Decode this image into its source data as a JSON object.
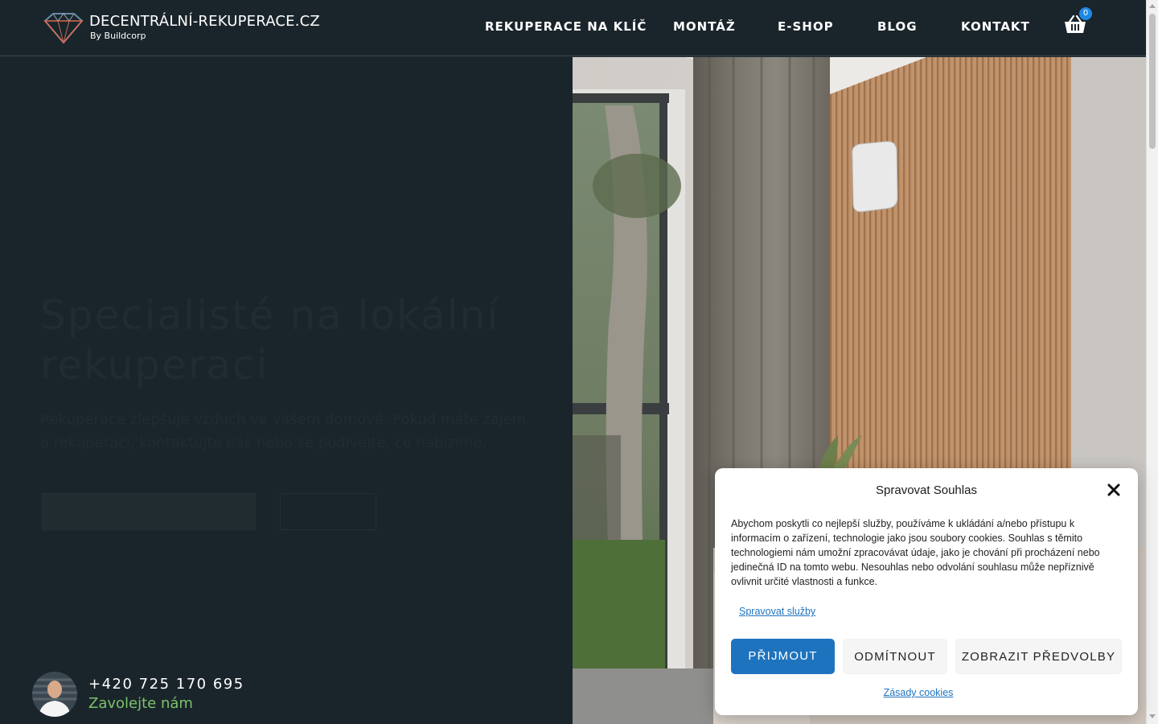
{
  "header": {
    "logo_title": "DECENTRÁLNÍ-REKUPERACE.CZ",
    "logo_subtitle": "By Buildcorp",
    "nav": [
      {
        "label": "REKUPERACE NA KLÍČ"
      },
      {
        "label": "MONTÁŽ"
      },
      {
        "label": "E-SHOP"
      },
      {
        "label": "BLOG"
      },
      {
        "label": "KONTAKT"
      }
    ],
    "cart_count": "0",
    "cart_icon": "basket-icon"
  },
  "hero": {
    "title": "Specialisté na lokální rekuperaci",
    "text": "Rekuperace zlepšuje vzduch ve vašem domově. Pokud máte zájem o rekuperaci, kontaktujte nás nebo se podívejte, co nabízíme.",
    "button_primary": "",
    "button_secondary": ""
  },
  "contact": {
    "phone": "+420 725 170 695",
    "call_label": "Zavolejte nám"
  },
  "cookie": {
    "title": "Spravovat Souhlas",
    "body": "Abychom poskytli co nejlepší služby, používáme k ukládání a/nebo přístupu k informacím o zařízení, technologie jako jsou soubory cookies. Souhlas s těmito technologiemi nám umožní zpracovávat údaje, jako je chování při procházení nebo jedinečná ID na tomto webu. Nesouhlas nebo odvolání souhlasu může nepříznivě ovlivnit určité vlastnosti a funkce.",
    "manage_services": "Spravovat služby",
    "accept": "PŘIJMOUT",
    "deny": "ODMÍTNOUT",
    "preferences": "ZOBRAZIT PŘEDVOLBY",
    "policy": "Zásady cookies"
  },
  "colors": {
    "background": "#1a252b",
    "accent_blue": "#1e73be",
    "call_green": "#7cc26b",
    "badge_blue": "#1e88e5"
  }
}
